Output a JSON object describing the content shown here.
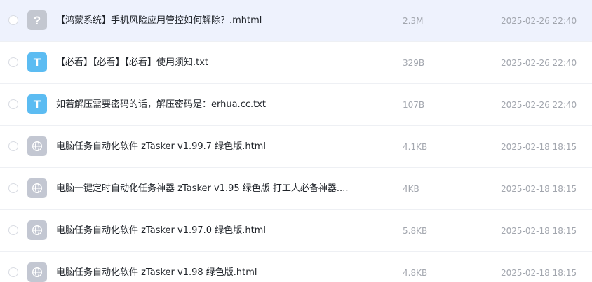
{
  "colors": {
    "selected_row_bg": "#eef2fd",
    "txt_icon": "#5cbcf2",
    "html_icon": "#c3c7d2",
    "unknown_icon": "#c3c7d0",
    "meta_text": "#a2a6ae"
  },
  "files": [
    {
      "name": "【鸿蒙系统】手机风险应用管控如何解除？.mhtml",
      "size": "2.3M",
      "date": "2025-02-26 22:40",
      "icon": "question-file-icon",
      "selected": true
    },
    {
      "name": "【必看】【必看】【必看】使用须知.txt",
      "size": "329B",
      "date": "2025-02-26 22:40",
      "icon": "txt-file-icon",
      "selected": false
    },
    {
      "name": "如若解压需要密码的话，解压密码是：erhua.cc.txt",
      "size": "107B",
      "date": "2025-02-26 22:40",
      "icon": "txt-file-icon",
      "selected": false
    },
    {
      "name": "电脑任务自动化软件 zTasker v1.99.7 绿色版.html",
      "size": "4.1KB",
      "date": "2025-02-18 18:15",
      "icon": "globe-file-icon",
      "selected": false
    },
    {
      "name": "电脑一键定时自动化任务神器 zTasker v1.95 绿色版 打工人必备神器....",
      "size": "4KB",
      "date": "2025-02-18 18:15",
      "icon": "globe-file-icon",
      "selected": false
    },
    {
      "name": "电脑任务自动化软件 zTasker v1.97.0 绿色版.html",
      "size": "5.8KB",
      "date": "2025-02-18 18:15",
      "icon": "globe-file-icon",
      "selected": false
    },
    {
      "name": "电脑任务自动化软件 zTasker v1.98 绿色版.html",
      "size": "4.8KB",
      "date": "2025-02-18 18:15",
      "icon": "globe-file-icon",
      "selected": false
    }
  ]
}
